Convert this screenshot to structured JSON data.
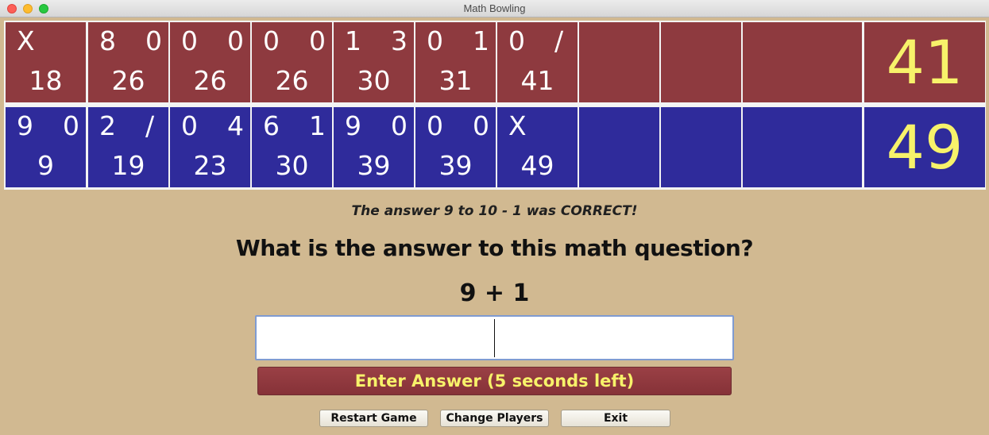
{
  "window": {
    "title": "Math Bowling"
  },
  "scoreboard": {
    "players": [
      {
        "color": "#8e3a3f",
        "frames": [
          {
            "r1": "X",
            "r2": "",
            "cum": "18"
          },
          {
            "r1": "8",
            "r2": "0",
            "cum": "26"
          },
          {
            "r1": "0",
            "r2": "0",
            "cum": "26"
          },
          {
            "r1": "0",
            "r2": "0",
            "cum": "26"
          },
          {
            "r1": "1",
            "r2": "3",
            "cum": "30"
          },
          {
            "r1": "0",
            "r2": "1",
            "cum": "31"
          },
          {
            "r1": "0",
            "r2": "/",
            "cum": "41"
          },
          {
            "r1": "",
            "r2": "",
            "cum": ""
          },
          {
            "r1": "",
            "r2": "",
            "cum": ""
          },
          {
            "r1": "",
            "r2": "",
            "cum": ""
          }
        ],
        "total": "41"
      },
      {
        "color": "#2f2b9b",
        "frames": [
          {
            "r1": "9",
            "r2": "0",
            "cum": "9"
          },
          {
            "r1": "2",
            "r2": "/",
            "cum": "19"
          },
          {
            "r1": "0",
            "r2": "4",
            "cum": "23"
          },
          {
            "r1": "6",
            "r2": "1",
            "cum": "30"
          },
          {
            "r1": "9",
            "r2": "0",
            "cum": "39"
          },
          {
            "r1": "0",
            "r2": "0",
            "cum": "39"
          },
          {
            "r1": "X",
            "r2": "",
            "cum": "49"
          },
          {
            "r1": "",
            "r2": "",
            "cum": ""
          },
          {
            "r1": "",
            "r2": "",
            "cum": ""
          },
          {
            "r1": "",
            "r2": "",
            "cum": ""
          }
        ],
        "total": "49"
      }
    ],
    "total_color": "#f7f26a"
  },
  "feedback": "The answer 9 to 10 - 1 was CORRECT!",
  "question": "What is the answer to this math question?",
  "equation": "9 + 1",
  "answer_input": {
    "value": "",
    "placeholder": ""
  },
  "enter_button": "Enter Answer (5 seconds left)",
  "buttons": {
    "restart": "Restart Game",
    "change_players": "Change Players",
    "exit": "Exit"
  }
}
